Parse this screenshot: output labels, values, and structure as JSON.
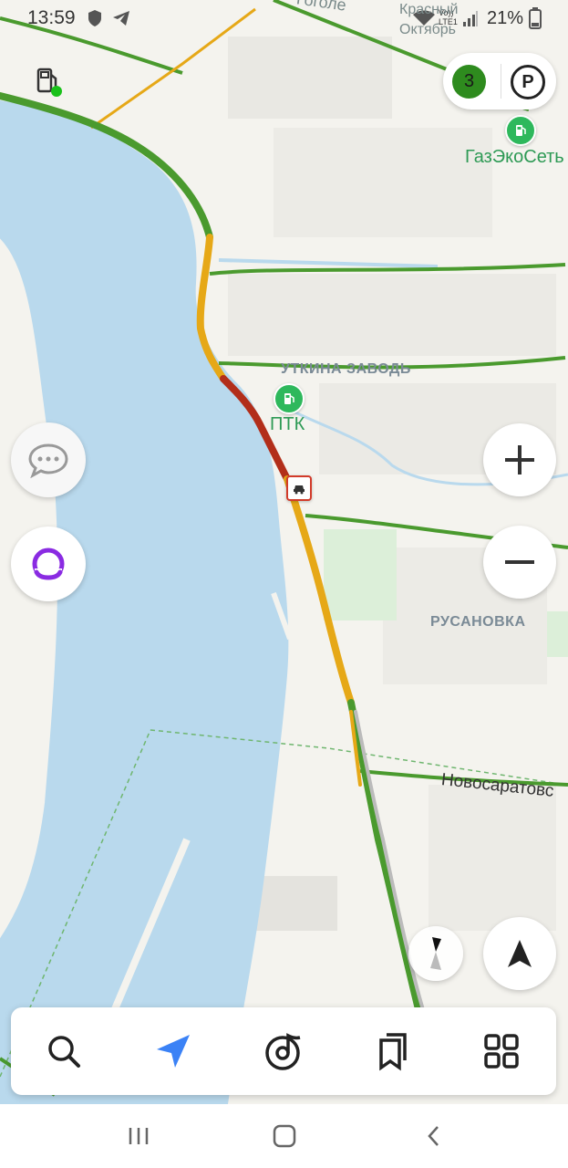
{
  "status_bar": {
    "time": "13:59",
    "volte_label": "Vo)) LTE1",
    "battery_percent": "21%",
    "icons": [
      "shield-icon",
      "telegram-icon",
      "wifi-icon",
      "signal-icon",
      "battery-icon"
    ]
  },
  "map": {
    "labels": {
      "top_fragment_1": "Гоголе",
      "top_fragment_2": "Красный",
      "top_fragment_3": "Октябрь",
      "gas_station_1": "ГазЭкоСеть",
      "district_1": "УТКИНА ЗАВОДЬ",
      "gas_station_2": "ПТК",
      "district_2": "РУСАНОВКА",
      "street_1": "Новосаратовс"
    },
    "colors": {
      "water": "#b9d9ed",
      "land": "#f4f3ee",
      "traffic_green": "#4a9a2e",
      "traffic_yellow": "#e6a817",
      "traffic_red": "#b22e1a",
      "accent_blue": "#3b82f6",
      "alice_purple": "#8a2be2"
    }
  },
  "controls": {
    "traffic_level": "3",
    "parking_label": "P",
    "icons": [
      "gas-station-icon",
      "chat-icon",
      "alice-icon",
      "zoom-in-icon",
      "zoom-out-icon",
      "compass-icon",
      "my-location-icon"
    ]
  },
  "bottom_tabs": [
    "search-icon",
    "navigator-icon",
    "music-icon",
    "bookmarks-icon",
    "services-icon"
  ],
  "system_nav": [
    "recent-apps-icon",
    "home-icon",
    "back-icon"
  ]
}
